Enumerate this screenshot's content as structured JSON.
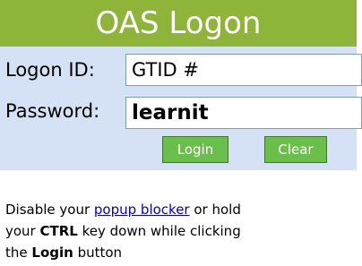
{
  "title": "OAS Logon",
  "logon_id": {
    "label": "Logon ID:",
    "value": "GTID #"
  },
  "password": {
    "label": "Password:",
    "value": "learnit"
  },
  "buttons": {
    "login": "Login",
    "clear": "Clear"
  },
  "note": {
    "line1_prefix": "Disable your ",
    "popup_link": "popup blocker",
    "line1_suffix": " or hold",
    "line2_prefix": "your ",
    "ctrl": "CTRL",
    "line2_suffix": " key down while clicking",
    "line3_prefix": "the ",
    "login": "Login",
    "line3_suffix": " button"
  },
  "colors": {
    "title_bar": "#8eb53a",
    "panel": "#d5e2f5",
    "button": "#6abf4b",
    "link": "#0000cc"
  }
}
